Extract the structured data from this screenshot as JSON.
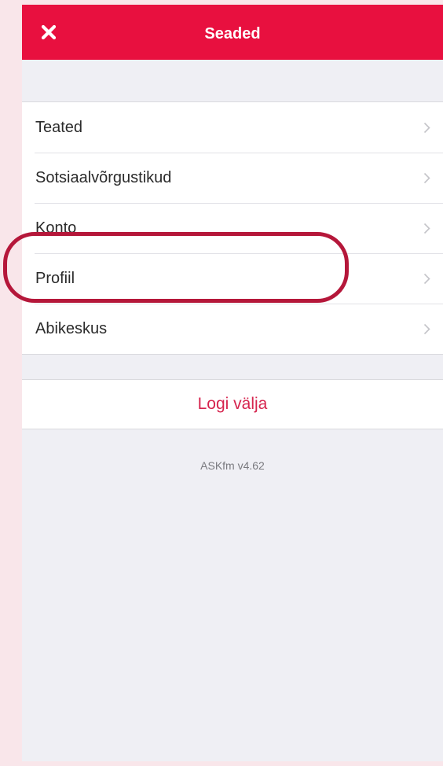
{
  "header": {
    "title": "Seaded",
    "close_icon": "close-icon"
  },
  "settings": {
    "items": [
      {
        "label": "Teated"
      },
      {
        "label": "Sotsiaalvõrgustikud"
      },
      {
        "label": "Konto"
      },
      {
        "label": "Profiil"
      },
      {
        "label": "Abikeskus"
      }
    ]
  },
  "logout": {
    "label": "Logi välja"
  },
  "footer": {
    "version": "ASKfm v4.62"
  },
  "colors": {
    "brand": "#e8103f",
    "logout_text": "#d6244e",
    "highlight": "#b5173a",
    "background": "#efeff4",
    "page_background": "#f9e6ea"
  },
  "annotation": {
    "highlighted_item": "Profiil"
  }
}
